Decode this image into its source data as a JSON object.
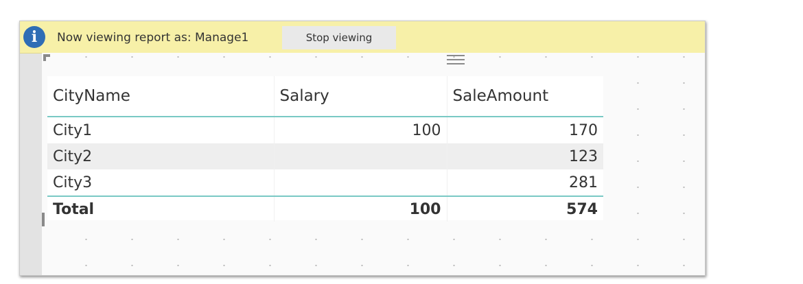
{
  "banner": {
    "icon": "info-icon",
    "message": "Now viewing report as: Manage1",
    "stop_label": "Stop viewing"
  },
  "table": {
    "columns": [
      "CityName",
      "Salary",
      "SaleAmount"
    ],
    "rows": [
      {
        "city": "City1",
        "salary": "100",
        "sale": "170"
      },
      {
        "city": "City2",
        "salary": "",
        "sale": "123"
      },
      {
        "city": "City3",
        "salary": "",
        "sale": "281"
      }
    ],
    "total": {
      "label": "Total",
      "salary": "100",
      "sale": "574"
    }
  },
  "colors": {
    "banner_bg": "#f7f0a8",
    "info_blue": "#2f6db5",
    "accent_teal": "#79c9c4",
    "alt_row": "#eeeeee"
  }
}
